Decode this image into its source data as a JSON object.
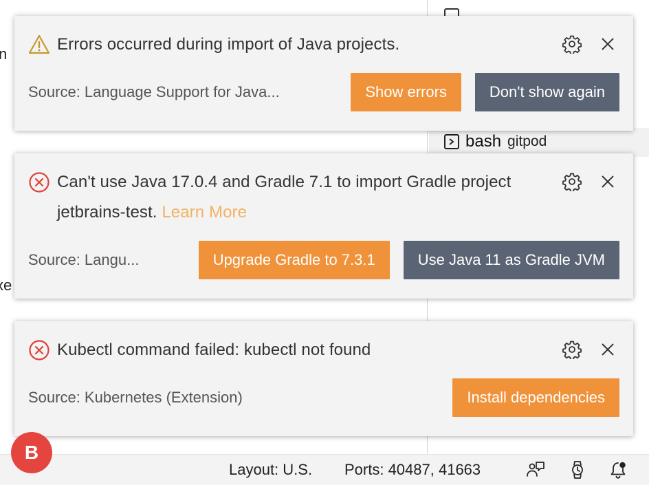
{
  "background": {
    "frag_left_1": "n",
    "frag_left_2": "xe",
    "terminal": {
      "name": "bash",
      "host": "gitpod"
    }
  },
  "notifications": [
    {
      "severity": "warning",
      "message": "Errors occurred during import of Java projects.",
      "source": "Source: Language Support for Java...",
      "buttons": [
        {
          "label": "Show errors",
          "style": "primary"
        },
        {
          "label": "Don't show again",
          "style": "secondary"
        }
      ]
    },
    {
      "severity": "error",
      "message": "Can't use Java 17.0.4 and Gradle 7.1 to import Gradle project jetbrains-test.",
      "link": "Learn More",
      "source": "Source: Langu...",
      "buttons": [
        {
          "label": "Upgrade Gradle to 7.3.1",
          "style": "primary"
        },
        {
          "label": "Use Java 11 as Gradle JVM",
          "style": "secondary"
        }
      ]
    },
    {
      "severity": "error",
      "message": "Kubectl command failed: kubectl not found",
      "source": "Source: Kubernetes (Extension)",
      "buttons": [
        {
          "label": "Install dependencies",
          "style": "primary"
        }
      ]
    }
  ],
  "status_bar": {
    "avatar_letter": "B",
    "layout": "Layout: U.S.",
    "ports": "Ports: 40487, 41663",
    "icons": [
      "feedback-icon",
      "watch-icon",
      "bell-notification-icon"
    ]
  },
  "colors": {
    "primary_button": "#f0923a",
    "secondary_button": "#5b6474",
    "warning": "#c49a2c",
    "error": "#e0413a",
    "link": "#f2b263",
    "avatar": "#e5453f",
    "toast_bg": "#f3f3f3"
  }
}
